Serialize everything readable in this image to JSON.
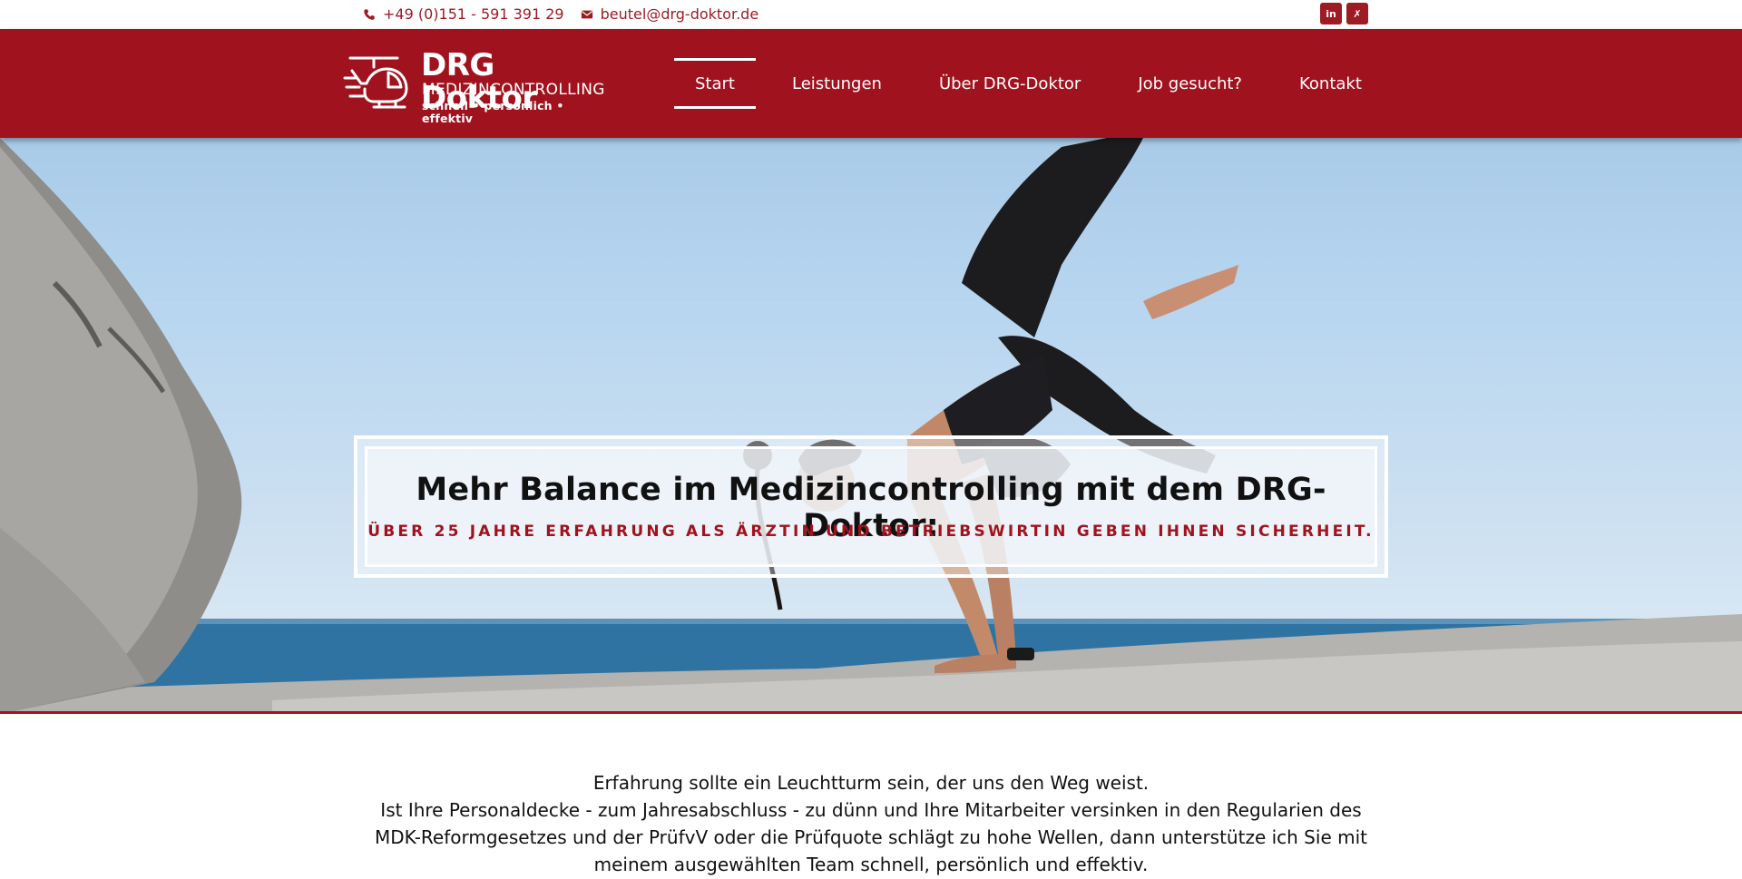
{
  "topbar": {
    "phone": "+49 (0)151 - 591 391 29",
    "email": "beutel@drg-doktor.de",
    "social": [
      {
        "name": "linkedin-icon",
        "glyph": "in"
      },
      {
        "name": "xing-icon",
        "glyph": "✗"
      }
    ]
  },
  "logo": {
    "brand": "DRG Doktor",
    "sub": "MEDIZINCONTROLLING",
    "tagline": "schnell • persönlich • effektiv"
  },
  "nav": {
    "items": [
      {
        "label": "Start",
        "active": true
      },
      {
        "label": "Leistungen",
        "active": false
      },
      {
        "label": "Über DRG-Doktor",
        "active": false
      },
      {
        "label": "Job gesucht?",
        "active": false
      },
      {
        "label": "Kontakt",
        "active": false
      }
    ]
  },
  "hero": {
    "title": "Mehr Balance im Medizincontrolling mit dem DRG-Doktor:",
    "subtitle": "ÜBER 25 JAHRE ERFAHRUNG ALS ÄRZTIN UND BETRIEBSWIRTIN GEBEN IHNEN SICHERHEIT."
  },
  "intro": {
    "line1": "Erfahrung sollte ein Leuchtturm sein, der uns den Weg weist.",
    "line2": "Ist Ihre Personaldecke - zum Jahresabschluss - zu dünn und Ihre Mitarbeiter versinken in den Regularien des MDK-Reformgesetzes und der PrüfvV oder die Prüfquote schlägt zu hohe Wellen, dann unterstütze ich Sie mit meinem ausgewählten Team schnell, persönlich und effektiv."
  },
  "colors": {
    "brand_red": "#a0131e",
    "text": "#111111",
    "white": "#ffffff"
  }
}
